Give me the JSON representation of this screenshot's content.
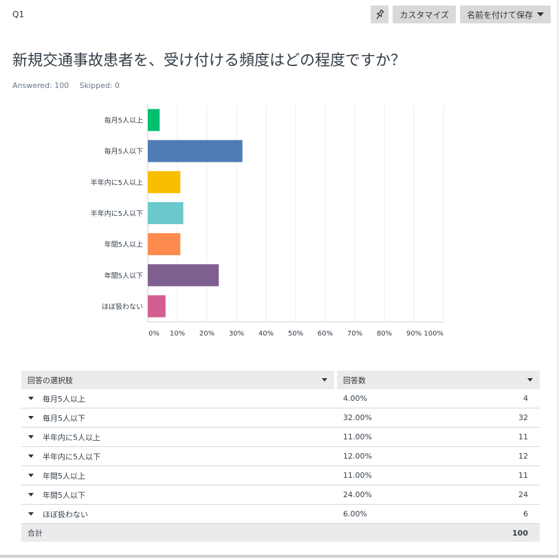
{
  "header": {
    "question_number": "Q1",
    "customize_label": "カスタマイズ",
    "save_label": "名前を付けて保存",
    "pin_icon": "pin-icon"
  },
  "question": {
    "title": "新規交通事故患者を、受け付ける頻度はどの程度ですか？",
    "answered": "Answered: 100",
    "skipped": "Skipped: 0"
  },
  "chart_data": {
    "type": "bar",
    "orientation": "horizontal",
    "categories": [
      "毎月5人以上",
      "毎月5人以下",
      "半年内に5人以上",
      "半年内に5人以下",
      "年間5人以上",
      "年間5人以下",
      "ほぼ扱わない"
    ],
    "values": [
      4,
      32,
      11,
      12,
      11,
      24,
      6
    ],
    "colors": [
      "#00bf6f",
      "#507cb6",
      "#f9be00",
      "#6bc8cd",
      "#ff8b4f",
      "#7f5f90",
      "#d25f90"
    ],
    "xlim": [
      0,
      100
    ],
    "x_ticks": [
      "0%",
      "10%",
      "20%",
      "30%",
      "40%",
      "50%",
      "60%",
      "70%",
      "80%",
      "90%",
      "100%"
    ],
    "grid": true,
    "title": "",
    "xlabel": "",
    "ylabel": ""
  },
  "table": {
    "header_choice": "回答の選択肢",
    "header_responses": "回答数",
    "rows": [
      {
        "label": "毎月5人以上",
        "percent": "4.00%",
        "count": "4"
      },
      {
        "label": "毎月5人以下",
        "percent": "32.00%",
        "count": "32"
      },
      {
        "label": "半年内に5人以上",
        "percent": "11.00%",
        "count": "11"
      },
      {
        "label": "半年内に5人以下",
        "percent": "12.00%",
        "count": "12"
      },
      {
        "label": "年間5人以上",
        "percent": "11.00%",
        "count": "11"
      },
      {
        "label": "年間5人以下",
        "percent": "24.00%",
        "count": "24"
      },
      {
        "label": "ほぼ扱わない",
        "percent": "6.00%",
        "count": "6"
      }
    ],
    "total_label": "合計",
    "total_value": "100"
  }
}
